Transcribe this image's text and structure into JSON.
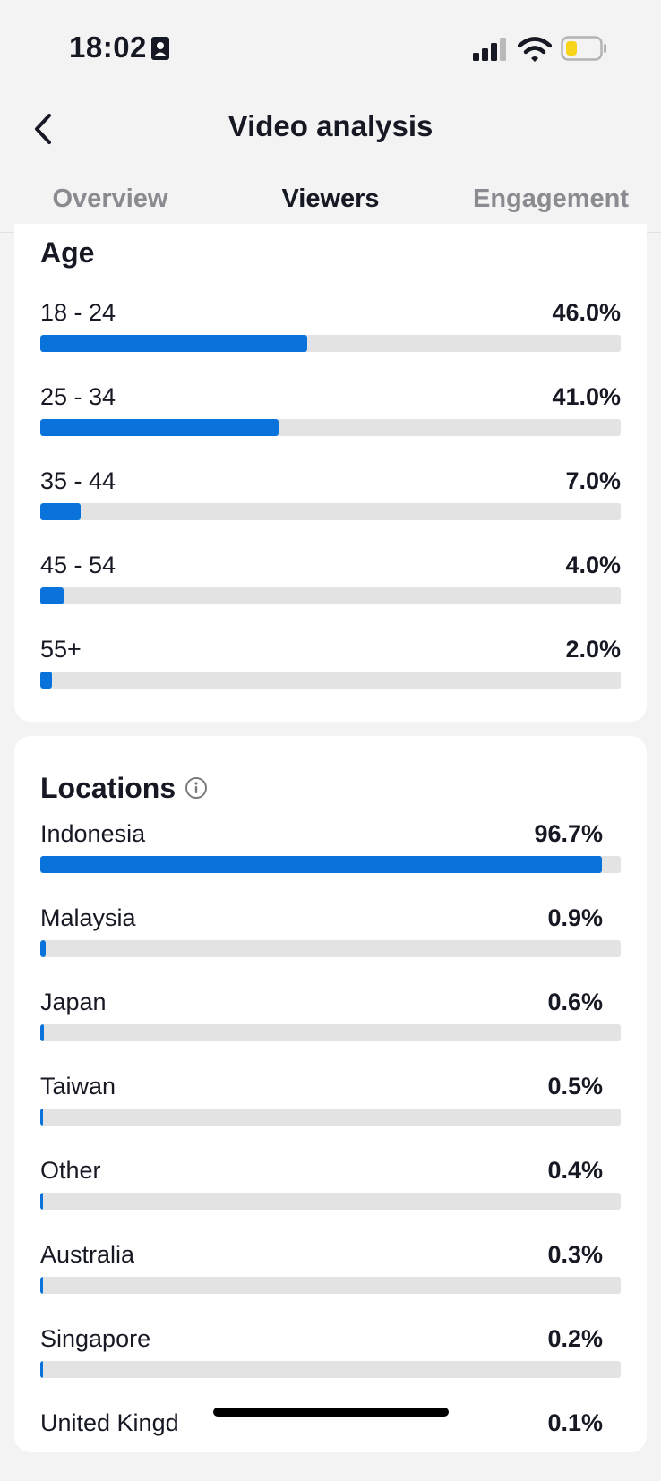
{
  "status_bar": {
    "time": "18:02"
  },
  "header": {
    "title": "Video analysis"
  },
  "tabs": [
    {
      "label": "Overview",
      "active": false
    },
    {
      "label": "Viewers",
      "active": true
    },
    {
      "label": "Engagement",
      "active": false
    }
  ],
  "age": {
    "heading": "Age",
    "rows": [
      {
        "label": "18 - 24",
        "value": "46.0%",
        "fraction": 0.46
      },
      {
        "label": "25 - 34",
        "value": "41.0%",
        "fraction": 0.41
      },
      {
        "label": "35 - 44",
        "value": "7.0%",
        "fraction": 0.07
      },
      {
        "label": "45 - 54",
        "value": "4.0%",
        "fraction": 0.04
      },
      {
        "label": "55+",
        "value": "2.0%",
        "fraction": 0.02
      }
    ]
  },
  "locations": {
    "heading": "Locations",
    "rows": [
      {
        "label": "Indonesia",
        "value": "96.7%",
        "fraction": 0.967
      },
      {
        "label": "Malaysia",
        "value": "0.9%",
        "fraction": 0.009
      },
      {
        "label": "Japan",
        "value": "0.6%",
        "fraction": 0.006
      },
      {
        "label": "Taiwan",
        "value": "0.5%",
        "fraction": 0.005
      },
      {
        "label": "Other",
        "value": "0.4%",
        "fraction": 0.004
      },
      {
        "label": "Australia",
        "value": "0.3%",
        "fraction": 0.003
      },
      {
        "label": "Singapore",
        "value": "0.2%",
        "fraction": 0.002
      },
      {
        "label": "United Kingd",
        "value": "0.1%",
        "fraction": 0.001
      }
    ]
  },
  "colors": {
    "accent": "#0a73db",
    "track": "#e3e3e3",
    "background": "#f3f3f3"
  },
  "icons": {
    "back": "chevron-left-icon",
    "info": "info-icon",
    "signal": "signal-icon",
    "wifi": "wifi-icon",
    "battery": "battery-icon",
    "badge": "id-badge-icon"
  }
}
